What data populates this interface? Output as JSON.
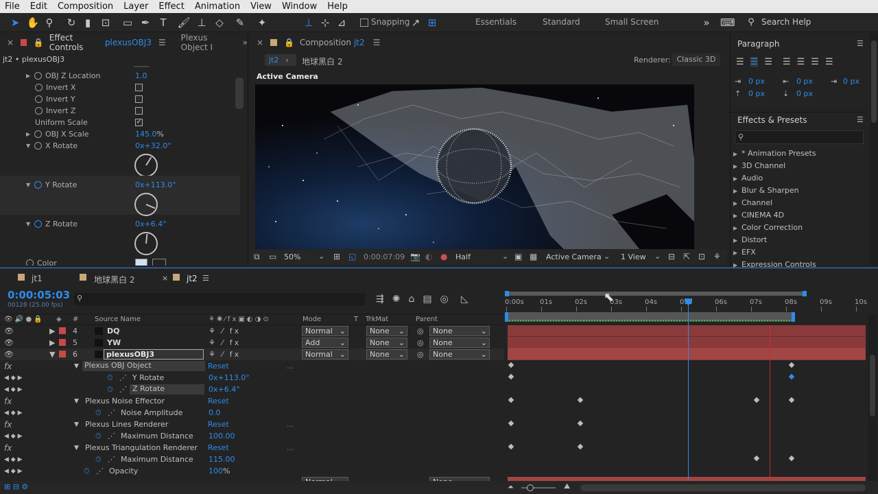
{
  "menu": [
    "File",
    "Edit",
    "Composition",
    "Layer",
    "Effect",
    "Animation",
    "View",
    "Window",
    "Help"
  ],
  "toolbar": {
    "snapping": "Snapping",
    "workspaces": [
      "Essentials",
      "Standard",
      "Small Screen"
    ],
    "search_help": "Search Help"
  },
  "effect_controls": {
    "tab_label": "Effect Controls",
    "tab_layer": "plexusOBJ3",
    "tab2": "Plexus Object I",
    "breadcrumb": "jt2 • plexusOBJ3",
    "rows": [
      {
        "label": "OBJ Z Location",
        "value": "1.0"
      },
      {
        "label": "Invert X"
      },
      {
        "label": "Invert Y"
      },
      {
        "label": "Invert Z"
      },
      {
        "label": "Uniform Scale"
      },
      {
        "label": "OBJ X Scale",
        "value": "145.0",
        "unit": "%"
      },
      {
        "label": "X Rotate",
        "value": "0x+32.0°"
      },
      {
        "label": "Y Rotate",
        "value": "0x+113.0°"
      },
      {
        "label": "Z Rotate",
        "value": "0x+6.4°"
      },
      {
        "label": "Color"
      }
    ]
  },
  "composition": {
    "tab_label": "Composition",
    "tab_name": "jt2",
    "crumb_comp": "jt2",
    "crumb_child": "地球黑白 2",
    "renderer_label": "Renderer:",
    "renderer_value": "Classic 3D",
    "active_camera_label": "Active Camera",
    "zoom": "50%",
    "timecode": "0:00:07:09",
    "resolution": "Half",
    "camera": "Active Camera",
    "view": "1 View"
  },
  "paragraph": {
    "title": "Paragraph",
    "indent_left": "0 px",
    "indent_right": "0 px",
    "indent_first": "0 px",
    "space_before": "0 px",
    "space_after": "0 px"
  },
  "effects_presets": {
    "title": "Effects & Presets",
    "search_placeholder": "",
    "items": [
      "* Animation Presets",
      "3D Channel",
      "Audio",
      "Blur & Sharpen",
      "Channel",
      "CINEMA 4D",
      "Color Correction",
      "Distort",
      "EFX",
      "Expression Controls"
    ]
  },
  "timeline": {
    "tabs": [
      "jt1",
      "地球黑白 2",
      "jt2"
    ],
    "timecode": "0:00:05:03",
    "frame_info": "00128 (25.00 fps)",
    "columns": {
      "source_name": "Source Name",
      "mode": "Mode",
      "t": "T",
      "trkmat": "TrkMat",
      "parent": "Parent"
    },
    "ruler": [
      "0:00s",
      "01s",
      "02s",
      "03s",
      "04s",
      "05s",
      "06s",
      "07s",
      "08s",
      "09s",
      "10s"
    ],
    "layers": [
      {
        "num": "4",
        "name": "DQ",
        "mode": "Normal",
        "trkmat": "None",
        "parent": "None"
      },
      {
        "num": "5",
        "name": "YW",
        "mode": "Add",
        "trkmat": "None",
        "parent": "None"
      },
      {
        "num": "6",
        "name": "plexusOBJ3",
        "mode": "Normal",
        "trkmat": "None",
        "parent": "None"
      }
    ],
    "props": [
      {
        "name": "Plexus OBJ Object",
        "value": "Reset",
        "type": "effect"
      },
      {
        "name": "Y Rotate",
        "value": "0x+113.0°",
        "type": "prop"
      },
      {
        "name": "Z Rotate",
        "value": "0x+6.4°",
        "type": "prop"
      },
      {
        "name": "Plexus Noise Effector",
        "value": "Reset",
        "type": "effect"
      },
      {
        "name": "Noise Amplitude",
        "value": "0.0",
        "type": "prop"
      },
      {
        "name": "Plexus Lines Renderer",
        "value": "Reset",
        "type": "effect"
      },
      {
        "name": "Maximum Distance",
        "value": "100.00",
        "type": "prop"
      },
      {
        "name": "Plexus Triangulation Renderer",
        "value": "Reset",
        "type": "effect"
      },
      {
        "name": "Maximum Distance",
        "value": "115.00",
        "type": "prop"
      },
      {
        "name": "Opacity",
        "value": "100",
        "unit": "%",
        "type": "prop"
      }
    ],
    "reset_dots": "...",
    "next_layer_mode": "Normal",
    "next_layer_parent": "None"
  }
}
